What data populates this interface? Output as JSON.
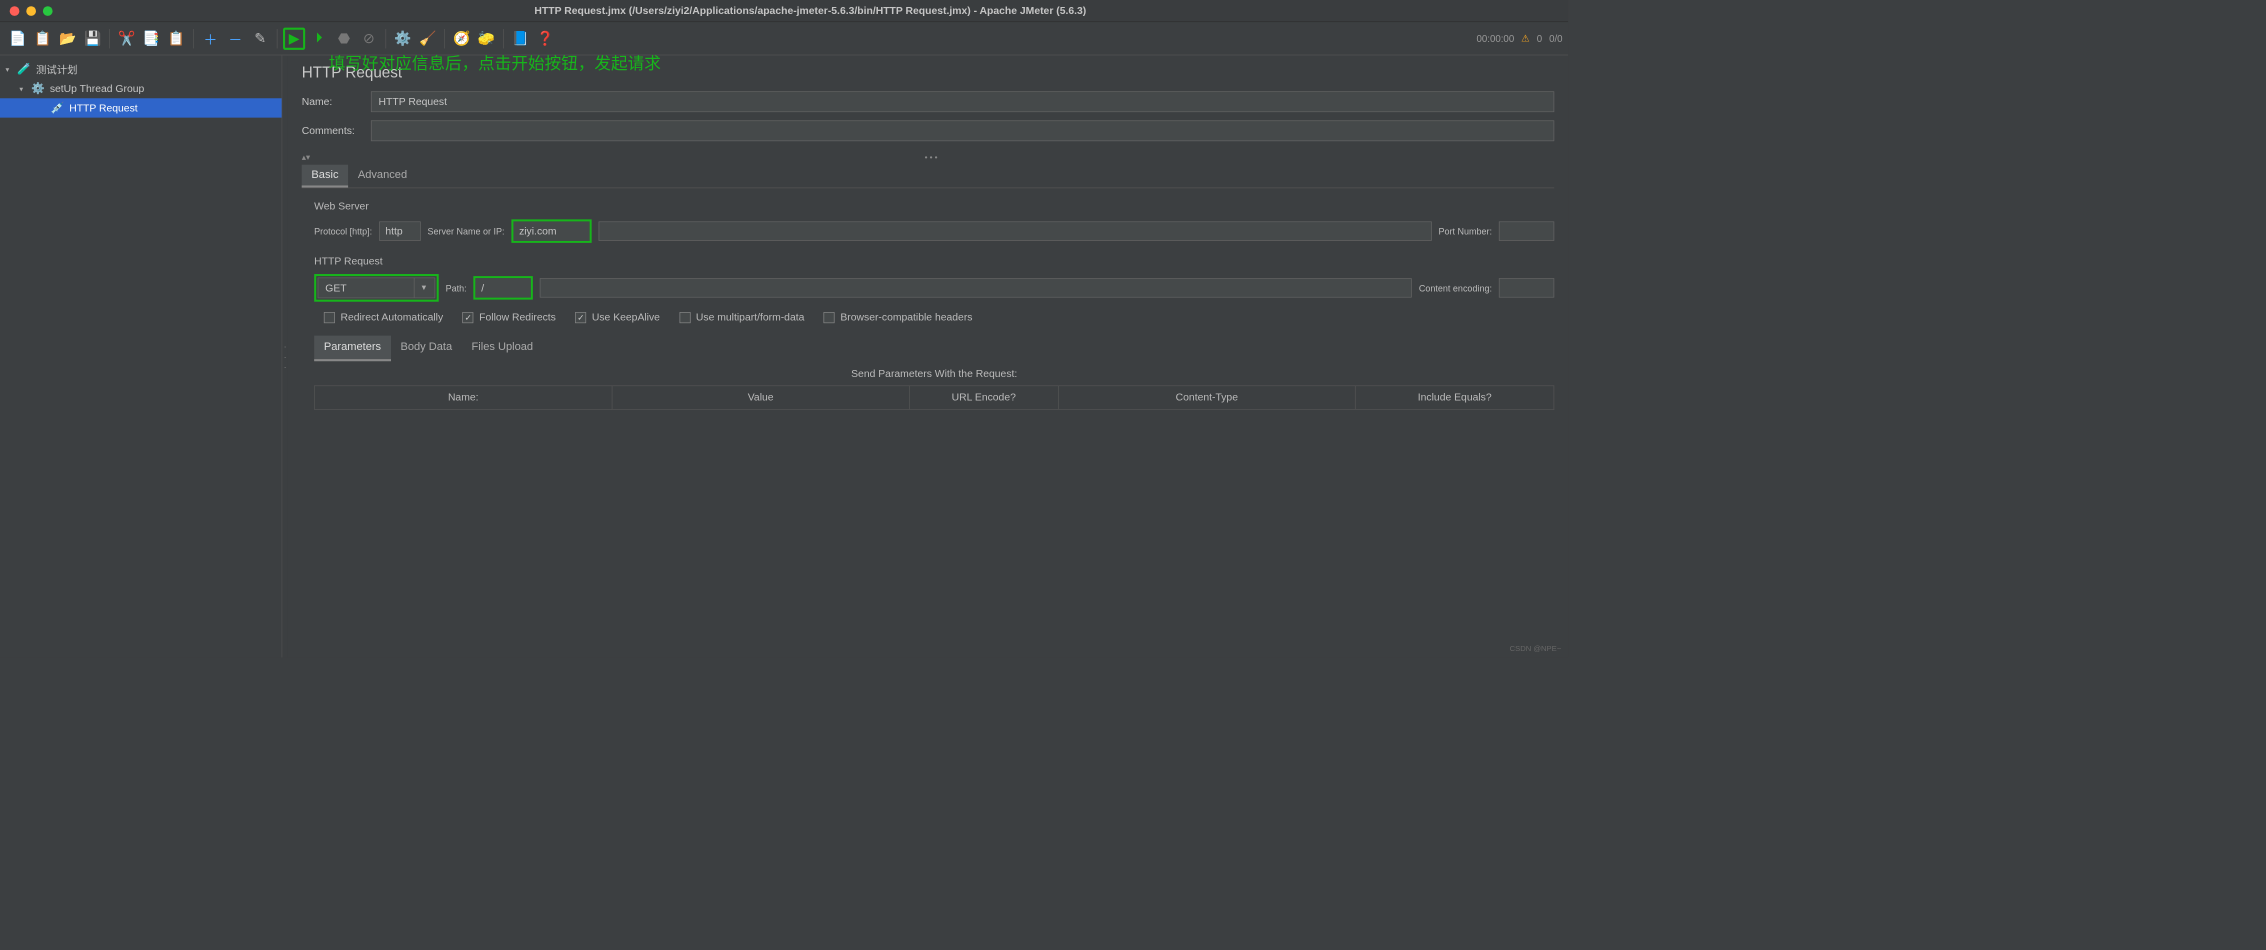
{
  "title": "HTTP Request.jmx (/Users/ziyi2/Applications/apache-jmeter-5.6.3/bin/HTTP Request.jmx) - Apache JMeter (5.6.3)",
  "annotation": "填写好对应信息后，点击开始按钮，发起请求",
  "status": {
    "elapsed": "00:00:00",
    "errors": "0",
    "threads": "0/0"
  },
  "tree": {
    "root": "测试计划",
    "group": "setUp Thread Group",
    "sampler": "HTTP Request"
  },
  "panel": {
    "heading": "HTTP Request",
    "name_label": "Name:",
    "name_value": "HTTP Request",
    "comments_label": "Comments:",
    "comments_value": "",
    "tabs": {
      "basic": "Basic",
      "advanced": "Advanced"
    },
    "web_server": {
      "legend": "Web Server",
      "protocol_label": "Protocol [http]:",
      "protocol_value": "http",
      "server_label": "Server Name or IP:",
      "server_value": "ziyi.com",
      "port_label": "Port Number:",
      "port_value": ""
    },
    "http_request": {
      "legend": "HTTP Request",
      "method": "GET",
      "path_label": "Path:",
      "path_value": "/",
      "enc_label": "Content encoding:",
      "enc_value": ""
    },
    "checks": {
      "redirect_auto": "Redirect Automatically",
      "follow": "Follow Redirects",
      "keepalive": "Use KeepAlive",
      "multipart": "Use multipart/form-data",
      "browser": "Browser-compatible headers"
    },
    "subtabs": {
      "params": "Parameters",
      "body": "Body Data",
      "files": "Files Upload"
    },
    "table": {
      "title": "Send Parameters With the Request:",
      "cols": [
        "Name:",
        "Value",
        "URL Encode?",
        "Content-Type",
        "Include Equals?"
      ]
    }
  },
  "watermark": "CSDN @NPE~"
}
